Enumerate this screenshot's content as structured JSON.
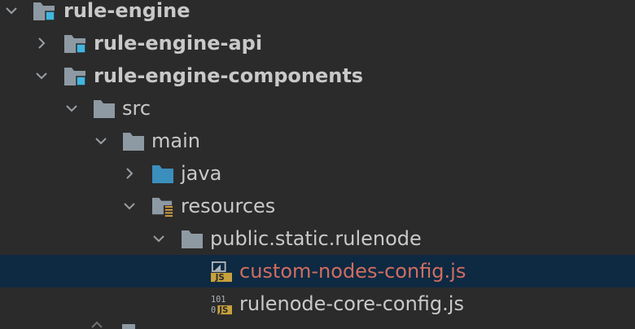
{
  "project_tree": {
    "items": [
      {
        "label": "rule-engine",
        "icon": "module-folder-icon",
        "chevron": "chevron-down-icon"
      },
      {
        "label": "rule-engine-api",
        "icon": "module-folder-icon",
        "chevron": "chevron-right-icon"
      },
      {
        "label": "rule-engine-components",
        "icon": "module-folder-icon",
        "chevron": "chevron-down-icon"
      },
      {
        "label": "src",
        "icon": "folder-icon",
        "chevron": "chevron-down-icon"
      },
      {
        "label": "main",
        "icon": "folder-icon",
        "chevron": "chevron-down-icon"
      },
      {
        "label": "java",
        "icon": "source-folder-icon",
        "chevron": "chevron-right-icon"
      },
      {
        "label": "resources",
        "icon": "resources-folder-icon",
        "chevron": "chevron-down-icon"
      },
      {
        "label": "public.static.rulenode",
        "icon": "folder-icon",
        "chevron": "chevron-down-icon"
      },
      {
        "label": "custom-nodes-config.js",
        "icon": "js-file-icon",
        "selected": true,
        "modified": true
      },
      {
        "label": "rulenode-core-config.js",
        "icon": "binary-js-file-icon"
      }
    ]
  },
  "colors": {
    "background": "#2b2b2b",
    "selection": "#0e2942",
    "text": "#c9c9c9",
    "modified_text": "#d16d5f",
    "folder": "#8e9aa3",
    "source_folder": "#3b8fbd",
    "module_marker": "#40b6e0",
    "js_badge": "#c7a13c"
  }
}
